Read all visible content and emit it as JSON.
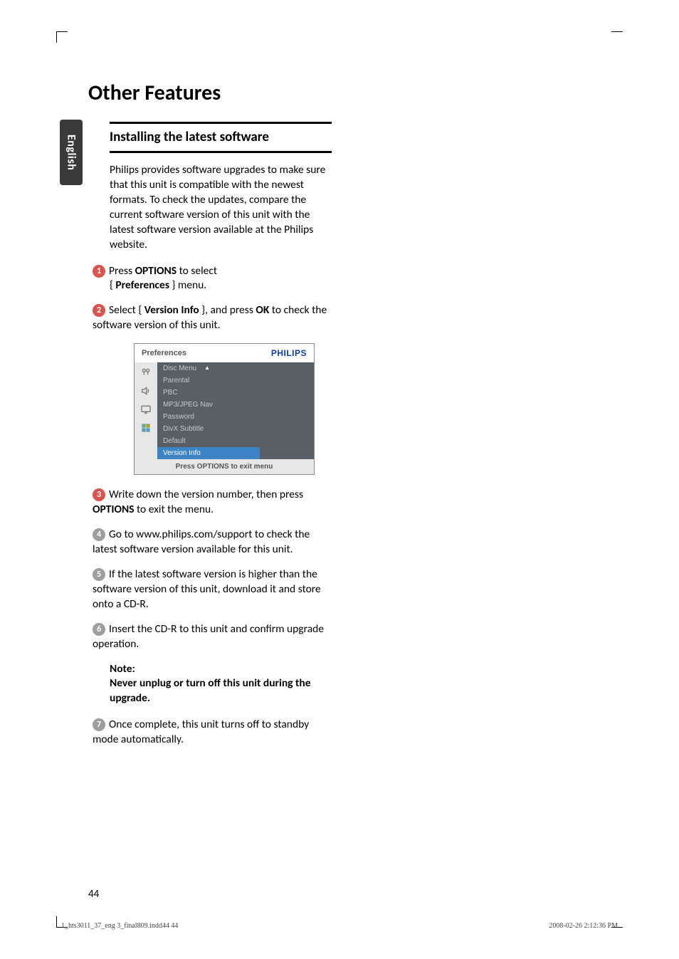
{
  "lang_tab": "English",
  "title": "Other Features",
  "section_heading": "Installing the latest software",
  "intro": "Philips provides software upgrades to make sure that this unit is compatible with the newest formats.  To check the updates, compare the current software version of this unit with the latest software version available at the Philips website.",
  "steps": {
    "s1a": "Press ",
    "s1b": "OPTIONS",
    "s1c": " to select",
    "s1d": "{ ",
    "s1e": "Preferences",
    "s1f": " } menu.",
    "s2a": "Select { ",
    "s2b": "Version Info",
    "s2c": " }, and press ",
    "s2d": "OK",
    "s2e": " to check the software version of this unit.",
    "s3a": "Write down the version number, then press ",
    "s3b": "OPTIONS",
    "s3c": " to exit the menu.",
    "s4": "Go to www.philips.com/support to check the latest software version available for this unit.",
    "s5": "If the latest software version is higher than the software version of this unit, download it and store onto a CD-R.",
    "s6": "Insert the CD-R to this unit and confirm upgrade operation.",
    "s7": "Once complete, this unit turns off to standby mode automatically."
  },
  "note": {
    "label": "Note:",
    "body": "Never unplug or turn off this unit during the upgrade."
  },
  "menu": {
    "title": "Preferences",
    "brand": "PHILIPS",
    "items": [
      "Disc Menu",
      "Parental",
      "PBC",
      "MP3/JPEG Nav",
      "Password",
      "DivX Subtitle",
      "Default",
      "Version Info"
    ],
    "footer": "Press OPTIONS to exit menu"
  },
  "page_number": "44",
  "footer_left": "1_hts3011_37_eng 3_final809.indd44   44",
  "footer_right": "2008-02-26   2:12:36 PM"
}
